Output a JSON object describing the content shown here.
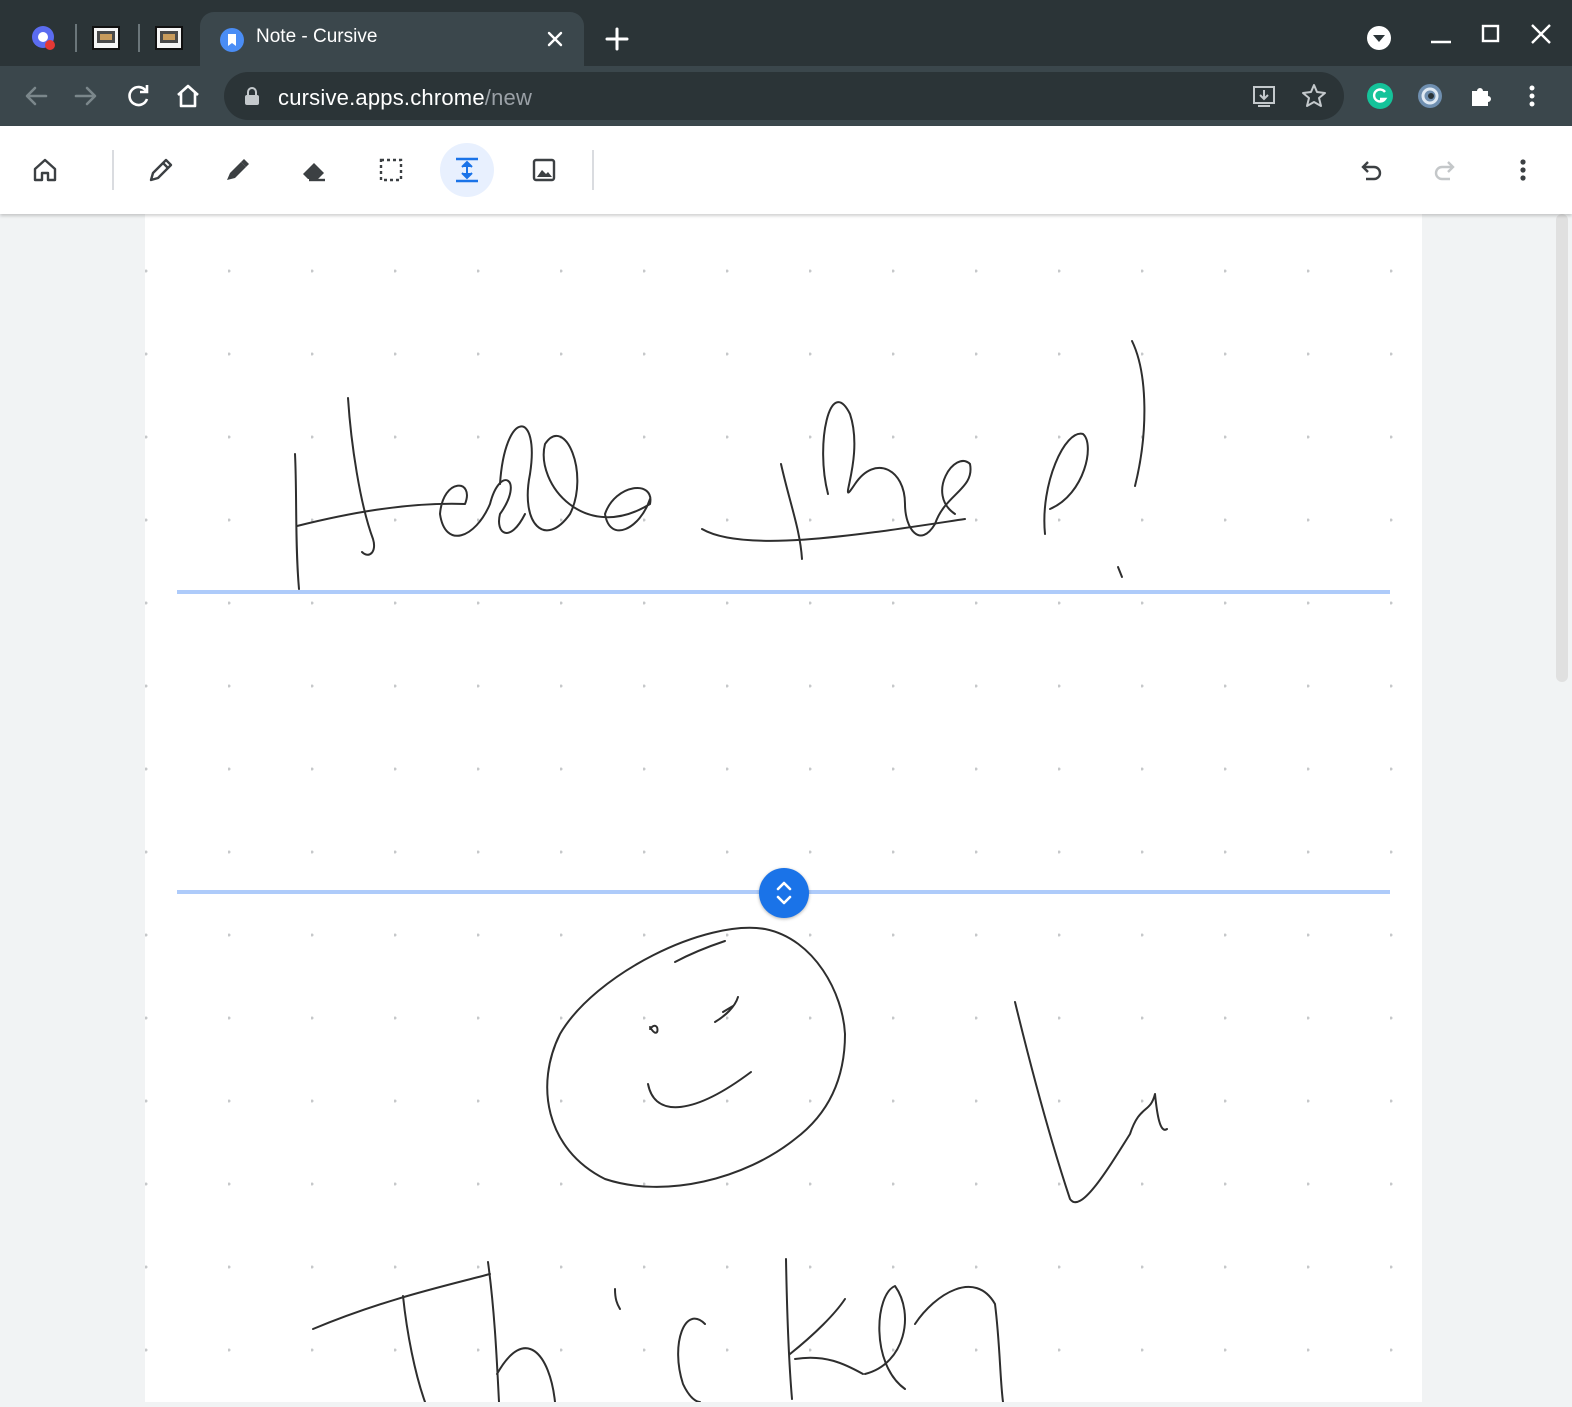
{
  "browser": {
    "active_tab": {
      "title": "Note - Cursive"
    },
    "address_bar": {
      "domain": "cursive.apps.chrome",
      "path": "/new"
    }
  },
  "canvas": {
    "handwriting": [
      "Hello there!",
      "Thicken"
    ]
  },
  "colors": {
    "tabstrip": "#2b3437",
    "toolbar": "#3b474c",
    "accent_blue": "#1a73e8",
    "space_line": "#aecbfa",
    "ink": "#2e2e2e"
  }
}
